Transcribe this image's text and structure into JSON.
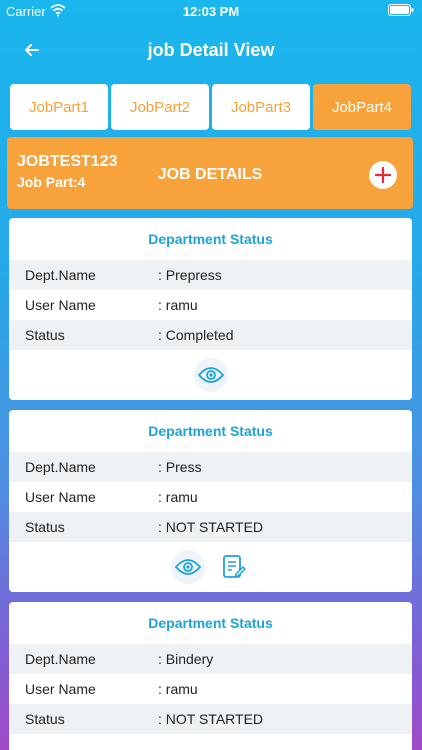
{
  "status_bar": {
    "carrier": "Carrier",
    "time": "12:03 PM"
  },
  "nav": {
    "title": "job Detail View"
  },
  "tabs": [
    {
      "label": "JobPart1",
      "active": false
    },
    {
      "label": "JobPart2",
      "active": false
    },
    {
      "label": "JobPart3",
      "active": false
    },
    {
      "label": "JobPart4",
      "active": true
    }
  ],
  "job": {
    "code": "JOBTEST123",
    "part": "Job Part:4",
    "details_label": "JOB DETAILS"
  },
  "cards": [
    {
      "title": "Department Status",
      "rows": [
        {
          "label": "Dept.Name",
          "value": ": Prepress"
        },
        {
          "label": "User Name",
          "value": ": ramu"
        },
        {
          "label": "Status",
          "value": ": Completed"
        }
      ]
    },
    {
      "title": "Department Status",
      "rows": [
        {
          "label": "Dept.Name",
          "value": ": Press"
        },
        {
          "label": "User Name",
          "value": ": ramu"
        },
        {
          "label": "Status",
          "value": ": NOT STARTED"
        }
      ]
    },
    {
      "title": "Department Status",
      "rows": [
        {
          "label": "Dept.Name",
          "value": ": Bindery"
        },
        {
          "label": "User Name",
          "value": ": ramu"
        },
        {
          "label": "Status",
          "value": ": NOT STARTED"
        }
      ]
    }
  ],
  "colors": {
    "accent": "#f7a23a",
    "title_blue": "#1aa4d9",
    "add_plus": "#e8283a"
  }
}
